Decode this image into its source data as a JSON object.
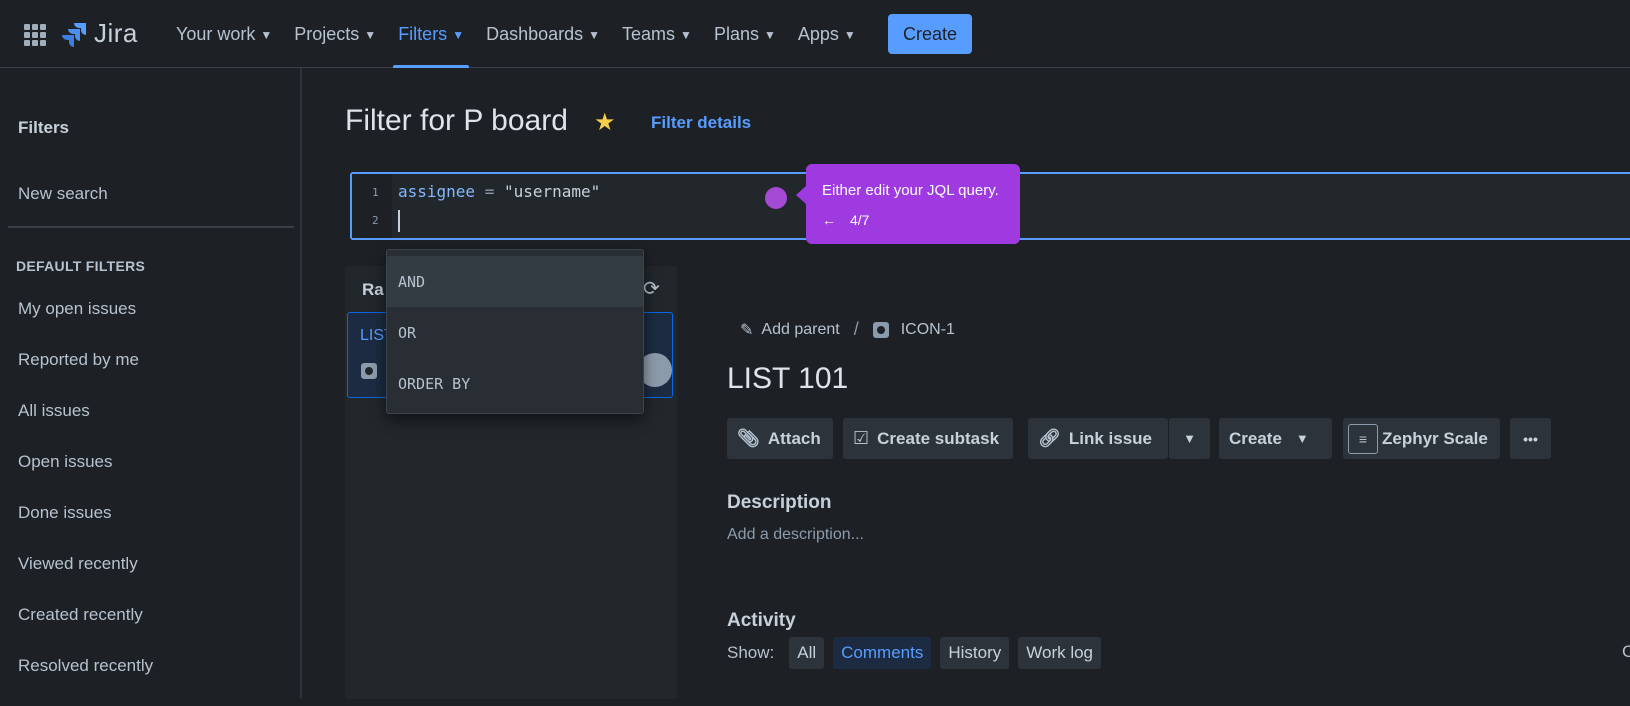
{
  "nav": {
    "logo_text": "Jira",
    "items": [
      {
        "label": "Your work",
        "active": false
      },
      {
        "label": "Projects",
        "active": false
      },
      {
        "label": "Filters",
        "active": true
      },
      {
        "label": "Dashboards",
        "active": false
      },
      {
        "label": "Teams",
        "active": false
      },
      {
        "label": "Plans",
        "active": false
      },
      {
        "label": "Apps",
        "active": false
      }
    ],
    "create_label": "Create",
    "accent_color": "#579dff"
  },
  "sidebar": {
    "title": "Filters",
    "new_search": "New search",
    "section_label": "DEFAULT FILTERS",
    "links": [
      "My open issues",
      "Reported by me",
      "All issues",
      "Open issues",
      "Done issues",
      "Viewed recently",
      "Created recently",
      "Resolved recently"
    ]
  },
  "header": {
    "title": "Filter for P board",
    "filter_details": "Filter details"
  },
  "jql": {
    "line_numbers": [
      "1",
      "2"
    ],
    "field": "assignee",
    "operator": "=",
    "value": "\"username\""
  },
  "tour": {
    "text": "Either edit your JQL query.",
    "back_arrow": "←",
    "step": "4/7",
    "color": "#9f3ae0"
  },
  "autocomplete": {
    "options": [
      "AND",
      "OR",
      "ORDER BY"
    ]
  },
  "list_panel": {
    "header": "Ra",
    "card_key": "LIST"
  },
  "issue": {
    "add_parent": "Add parent",
    "separator": "/",
    "key": "ICON-1",
    "title": "LIST 101",
    "toolbar": {
      "attach": "Attach",
      "create_subtask": "Create subtask",
      "link_issue": "Link issue",
      "create": "Create",
      "zephyr": "Zephyr Scale",
      "more": "•••"
    },
    "description_heading": "Description",
    "description_placeholder": "Add a description...",
    "activity_heading": "Activity",
    "show_label": "Show:",
    "activity_filters": [
      {
        "label": "All",
        "selected": false
      },
      {
        "label": "Comments",
        "selected": true
      },
      {
        "label": "History",
        "selected": false
      },
      {
        "label": "Work log",
        "selected": false
      }
    ],
    "edge_text": "C"
  }
}
